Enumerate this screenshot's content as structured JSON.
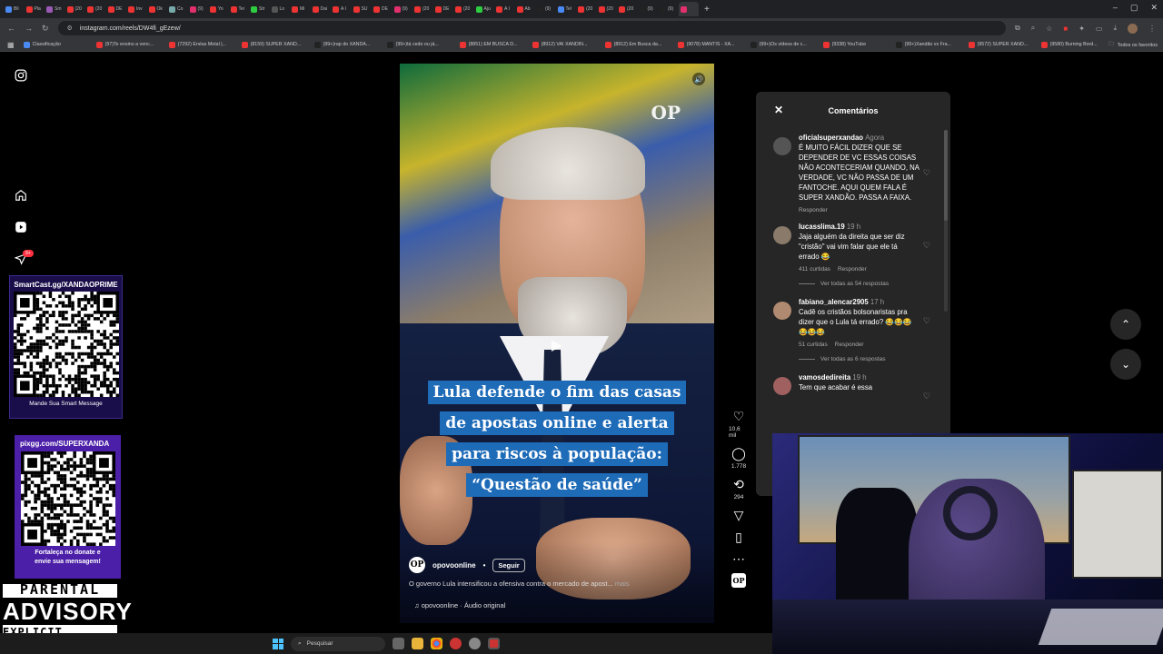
{
  "browser": {
    "tabs": [
      "Bli",
      "Pla",
      "Sm",
      "(20",
      "(20",
      "DE",
      "Inv",
      "Ok",
      "Co",
      "(9)",
      "Yo",
      "Tei",
      "Str",
      "Lo",
      "Mi",
      "Dai",
      "A I",
      "SU",
      "DE",
      "(9)",
      "(20",
      "DE",
      "(20",
      "Aju",
      "A I",
      "Ab",
      "(9)",
      "Tel",
      "(20",
      "(20",
      "(20",
      "(9)",
      "(9)",
      ""
    ],
    "tab_colors": [
      "#4a8af4",
      "#e33",
      "#9b59b6",
      "#e33",
      "#e33",
      "#e33",
      "#e33",
      "#e33",
      "#7aa",
      "#e1306c",
      "#e33",
      "#e33",
      "#2ecc40",
      "#555",
      "#e33",
      "#e33",
      "#e33",
      "#e33",
      "#e33",
      "#e1306c",
      "#e33",
      "#e33",
      "#e33",
      "#2ecc40",
      "#e33",
      "#e33",
      "#222",
      "#4a8af4",
      "#e33",
      "#e33",
      "#e33",
      "#222",
      "#222",
      "#e1306c"
    ],
    "active_tab_index": 33,
    "url": "instagram.com/reels/DW4fi_gEzew/",
    "bookmarks": [
      "Classificação",
      "(97)Te ensino a venc...",
      "(7292) Enéas Metal |...",
      "(8159) SUPER XAND...",
      "(99+)rap do XANDÃ...",
      "(99+)tá cedo ou já...",
      "(8851) EM BUSCA D...",
      "(8912) VAI XANDIN...",
      "(8912) Em Busca da...",
      "(9078) MANTIS - XA...",
      "(99+)Os vídeos de c...",
      "(9338) YouTube",
      "(99+)Xandão vs Fra...",
      "(9572) SUPER XAND...",
      "(9580) Burning Bord..."
    ],
    "bookmark_colors": [
      "#4a8af4",
      "#e33",
      "#e33",
      "#e33",
      "#222",
      "#222",
      "#e33",
      "#e33",
      "#e33",
      "#e33",
      "#222",
      "#e33",
      "#222",
      "#e33",
      "#e33"
    ],
    "all_bookmarks": "Todos os favoritos"
  },
  "sidebar": {
    "notif_badge": "9+"
  },
  "overlay": {
    "qr1_title": "SmartCast.gg/XANDAOPRIME",
    "qr1_footer": "Mande Sua Smart Message",
    "qr2_title": "pixgg.com/SUPERXANDA",
    "qr2_footer_1": "Fortaleça no donate e",
    "qr2_footer_2": "envie sua mensagem!",
    "advisory_1": "PARENTAL",
    "advisory_2": "ADVISORY",
    "advisory_3": "EXPLICIT CONTENT"
  },
  "reel": {
    "brand": "OP",
    "headline": "Lula defende o fim das casas de apostas online e alerta para riscos à população: “Questão de saúde”",
    "author": "opovoonline",
    "follow": "Seguir",
    "caption": "O governo Lula intensificou a ofensiva contra o mercado de apost...",
    "caption_more": "mais",
    "audio": "opovoonline · Áudio original"
  },
  "actions": {
    "likes": "10,6 mil",
    "comments": "1.778",
    "reposts": "294"
  },
  "comments_panel": {
    "title": "Comentários",
    "items": [
      {
        "user": "oficialsuperxandao",
        "time": "Agora",
        "text": "É MUITO FÁCIL DIZER QUE SE DEPENDER DE VC ESSAS COISAS NÃO ACONTECERIAM QUANDO, NA VERDADE, VC NÃO PASSA DE UM FANTOCHE. AQUI QUEM FALA É SUPER XANDÃO. PASSA A FAIXA.",
        "likes": "",
        "reply": "Responder",
        "replies": ""
      },
      {
        "user": "lucasslima.19",
        "time": "19 h",
        "text": "Jaja alguém da direita que ser diz \"cristão\" vai vim falar que ele tá errado 😂",
        "likes": "411 curtidas",
        "reply": "Responder",
        "replies": "Ver todas as 54 respostas"
      },
      {
        "user": "fabiano_alencar2905",
        "time": "17 h",
        "text": "Cadê os cristãos bolsonaristas pra dizer que o Lula tá errado? 😂😂😂😂😂😂",
        "likes": "51 curtidas",
        "reply": "Responder",
        "replies": "Ver todas as 6 respostas"
      },
      {
        "user": "vamosdedireita",
        "time": "19 h",
        "text": "Tem que acabar é essa",
        "likes": "",
        "reply": "",
        "replies": ""
      }
    ]
  },
  "taskbar": {
    "search": "Pesquisar"
  }
}
